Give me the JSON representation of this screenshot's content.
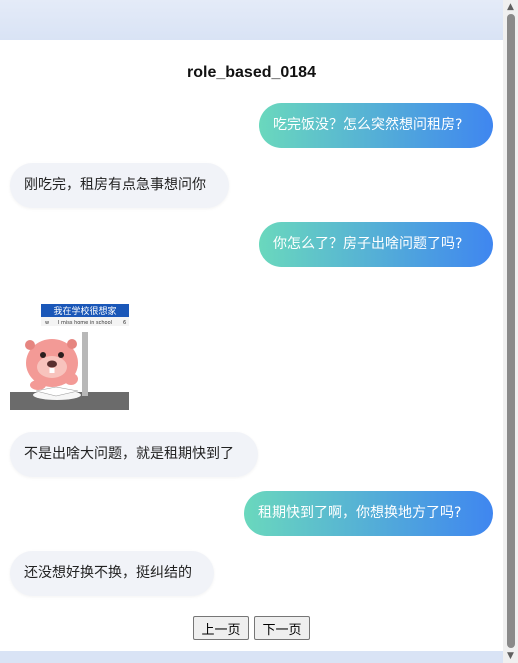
{
  "title": "role_based_0184",
  "messages": [
    {
      "side": "right",
      "text": "吃完饭没？怎么突然想问租房?"
    },
    {
      "side": "left",
      "text": "刚吃完，租房有点急事想问你"
    },
    {
      "side": "right",
      "text": "你怎么了？房子出啥问题了吗?"
    },
    {
      "side": "left",
      "sticker": "beaver-sticker"
    },
    {
      "side": "left",
      "text": "不是出啥大问题，就是租期快到了"
    },
    {
      "side": "right",
      "text": "租期快到了啊，你想换地方了吗?"
    },
    {
      "side": "left",
      "text": "还没想好换不换，挺纠结的"
    }
  ],
  "sticker": {
    "sign_text": "我在学校很想家",
    "sign_subtext": "I miss home in school",
    "sign_left": "w",
    "sign_right": "6"
  },
  "pagination": {
    "prev": "上一页",
    "next": "下一页"
  }
}
